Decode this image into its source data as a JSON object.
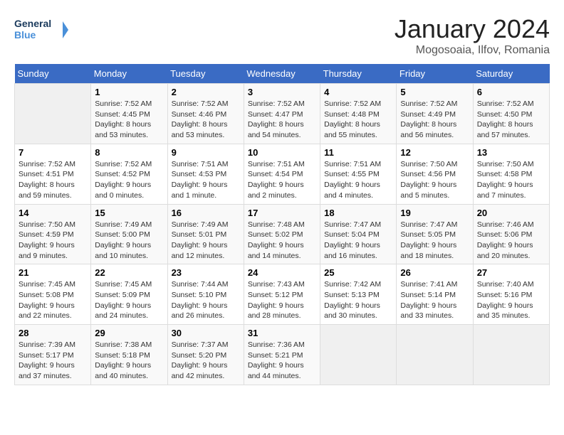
{
  "header": {
    "logo_line1": "General",
    "logo_line2": "Blue",
    "month": "January 2024",
    "location": "Mogosoaia, Ilfov, Romania"
  },
  "weekdays": [
    "Sunday",
    "Monday",
    "Tuesday",
    "Wednesday",
    "Thursday",
    "Friday",
    "Saturday"
  ],
  "weeks": [
    [
      {
        "day": "",
        "info": ""
      },
      {
        "day": "1",
        "info": "Sunrise: 7:52 AM\nSunset: 4:45 PM\nDaylight: 8 hours\nand 53 minutes."
      },
      {
        "day": "2",
        "info": "Sunrise: 7:52 AM\nSunset: 4:46 PM\nDaylight: 8 hours\nand 53 minutes."
      },
      {
        "day": "3",
        "info": "Sunrise: 7:52 AM\nSunset: 4:47 PM\nDaylight: 8 hours\nand 54 minutes."
      },
      {
        "day": "4",
        "info": "Sunrise: 7:52 AM\nSunset: 4:48 PM\nDaylight: 8 hours\nand 55 minutes."
      },
      {
        "day": "5",
        "info": "Sunrise: 7:52 AM\nSunset: 4:49 PM\nDaylight: 8 hours\nand 56 minutes."
      },
      {
        "day": "6",
        "info": "Sunrise: 7:52 AM\nSunset: 4:50 PM\nDaylight: 8 hours\nand 57 minutes."
      }
    ],
    [
      {
        "day": "7",
        "info": "Sunrise: 7:52 AM\nSunset: 4:51 PM\nDaylight: 8 hours\nand 59 minutes."
      },
      {
        "day": "8",
        "info": "Sunrise: 7:52 AM\nSunset: 4:52 PM\nDaylight: 9 hours\nand 0 minutes."
      },
      {
        "day": "9",
        "info": "Sunrise: 7:51 AM\nSunset: 4:53 PM\nDaylight: 9 hours\nand 1 minute."
      },
      {
        "day": "10",
        "info": "Sunrise: 7:51 AM\nSunset: 4:54 PM\nDaylight: 9 hours\nand 2 minutes."
      },
      {
        "day": "11",
        "info": "Sunrise: 7:51 AM\nSunset: 4:55 PM\nDaylight: 9 hours\nand 4 minutes."
      },
      {
        "day": "12",
        "info": "Sunrise: 7:50 AM\nSunset: 4:56 PM\nDaylight: 9 hours\nand 5 minutes."
      },
      {
        "day": "13",
        "info": "Sunrise: 7:50 AM\nSunset: 4:58 PM\nDaylight: 9 hours\nand 7 minutes."
      }
    ],
    [
      {
        "day": "14",
        "info": "Sunrise: 7:50 AM\nSunset: 4:59 PM\nDaylight: 9 hours\nand 9 minutes."
      },
      {
        "day": "15",
        "info": "Sunrise: 7:49 AM\nSunset: 5:00 PM\nDaylight: 9 hours\nand 10 minutes."
      },
      {
        "day": "16",
        "info": "Sunrise: 7:49 AM\nSunset: 5:01 PM\nDaylight: 9 hours\nand 12 minutes."
      },
      {
        "day": "17",
        "info": "Sunrise: 7:48 AM\nSunset: 5:02 PM\nDaylight: 9 hours\nand 14 minutes."
      },
      {
        "day": "18",
        "info": "Sunrise: 7:47 AM\nSunset: 5:04 PM\nDaylight: 9 hours\nand 16 minutes."
      },
      {
        "day": "19",
        "info": "Sunrise: 7:47 AM\nSunset: 5:05 PM\nDaylight: 9 hours\nand 18 minutes."
      },
      {
        "day": "20",
        "info": "Sunrise: 7:46 AM\nSunset: 5:06 PM\nDaylight: 9 hours\nand 20 minutes."
      }
    ],
    [
      {
        "day": "21",
        "info": "Sunrise: 7:45 AM\nSunset: 5:08 PM\nDaylight: 9 hours\nand 22 minutes."
      },
      {
        "day": "22",
        "info": "Sunrise: 7:45 AM\nSunset: 5:09 PM\nDaylight: 9 hours\nand 24 minutes."
      },
      {
        "day": "23",
        "info": "Sunrise: 7:44 AM\nSunset: 5:10 PM\nDaylight: 9 hours\nand 26 minutes."
      },
      {
        "day": "24",
        "info": "Sunrise: 7:43 AM\nSunset: 5:12 PM\nDaylight: 9 hours\nand 28 minutes."
      },
      {
        "day": "25",
        "info": "Sunrise: 7:42 AM\nSunset: 5:13 PM\nDaylight: 9 hours\nand 30 minutes."
      },
      {
        "day": "26",
        "info": "Sunrise: 7:41 AM\nSunset: 5:14 PM\nDaylight: 9 hours\nand 33 minutes."
      },
      {
        "day": "27",
        "info": "Sunrise: 7:40 AM\nSunset: 5:16 PM\nDaylight: 9 hours\nand 35 minutes."
      }
    ],
    [
      {
        "day": "28",
        "info": "Sunrise: 7:39 AM\nSunset: 5:17 PM\nDaylight: 9 hours\nand 37 minutes."
      },
      {
        "day": "29",
        "info": "Sunrise: 7:38 AM\nSunset: 5:18 PM\nDaylight: 9 hours\nand 40 minutes."
      },
      {
        "day": "30",
        "info": "Sunrise: 7:37 AM\nSunset: 5:20 PM\nDaylight: 9 hours\nand 42 minutes."
      },
      {
        "day": "31",
        "info": "Sunrise: 7:36 AM\nSunset: 5:21 PM\nDaylight: 9 hours\nand 44 minutes."
      },
      {
        "day": "",
        "info": ""
      },
      {
        "day": "",
        "info": ""
      },
      {
        "day": "",
        "info": ""
      }
    ]
  ]
}
